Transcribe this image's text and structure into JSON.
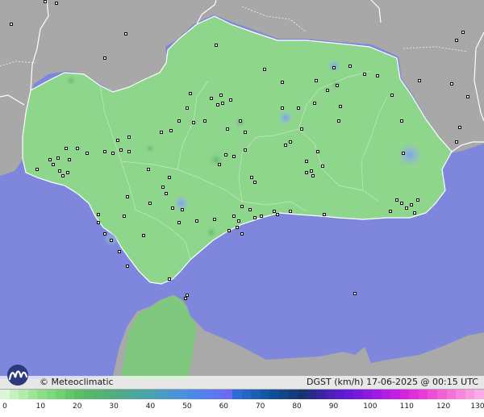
{
  "map": {
    "colors": {
      "sea": "#7f87dd",
      "land_outside": "#a9a9a9",
      "region_fill": "#8ed68c",
      "region_edge": "#7cc27a",
      "border": "#ffffff",
      "station": "#111111",
      "hotspot": "#7aa2e6"
    }
  },
  "footer": {
    "brand": "© Meteoclimatic",
    "product": "DGST (km/h)  17-06-2025 @ 00:15 UTC",
    "logo_icon": "meteoclimatic-logo-icon"
  },
  "scale": {
    "labels": [
      "0",
      "10",
      "20",
      "30",
      "40",
      "50",
      "60",
      "70",
      "80",
      "90",
      "100",
      "110",
      "120",
      "130"
    ],
    "colors": [
      "#d9f7d2",
      "#c5f1bf",
      "#b2ebac",
      "#9fe599",
      "#8cdf88",
      "#7dd97c",
      "#6fd171",
      "#63c767",
      "#5dbd66",
      "#58b86a",
      "#55b470",
      "#53b079",
      "#50ad83",
      "#4daa8e",
      "#4ba89a",
      "#4aa6a6",
      "#4aa1b5",
      "#4a9cc4",
      "#4b96d2",
      "#4c90de",
      "#4d8ae8",
      "#5183ee",
      "#577cf0",
      "#5e74f0",
      "#6a6bee",
      "#2f6bd6",
      "#2565c6",
      "#1c5eb6",
      "#1656a6",
      "#124e98",
      "#12468b",
      "#133d7e",
      "#173371",
      "#2a2a8a",
      "#3a25a0",
      "#4a20b6",
      "#5a1bcc",
      "#6a18d8",
      "#7c17df",
      "#8e18e2",
      "#a01ae3",
      "#b21ce3",
      "#c31fe2",
      "#d424e0",
      "#e02ddd",
      "#e93ada",
      "#ef4cd7",
      "#f45fd6",
      "#f772d8",
      "#f985dc",
      "#fa98e1",
      "#fbabe7"
    ]
  }
}
